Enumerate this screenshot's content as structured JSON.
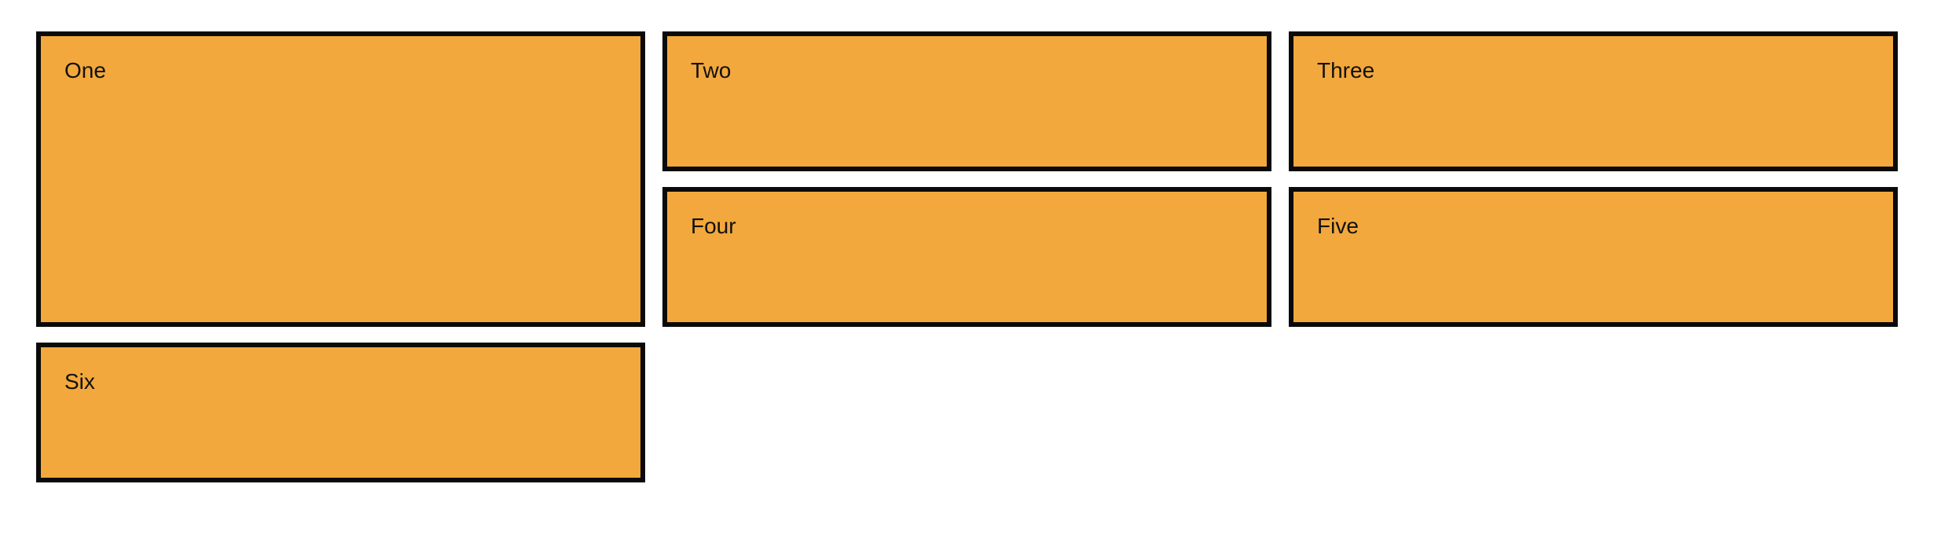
{
  "boxes": {
    "one": "One",
    "two": "Two",
    "three": "Three",
    "four": "Four",
    "five": "Five",
    "six": "Six"
  },
  "colors": {
    "box_fill": "#f2a83c",
    "box_border": "#0a0a0a",
    "background": "#ffffff"
  }
}
